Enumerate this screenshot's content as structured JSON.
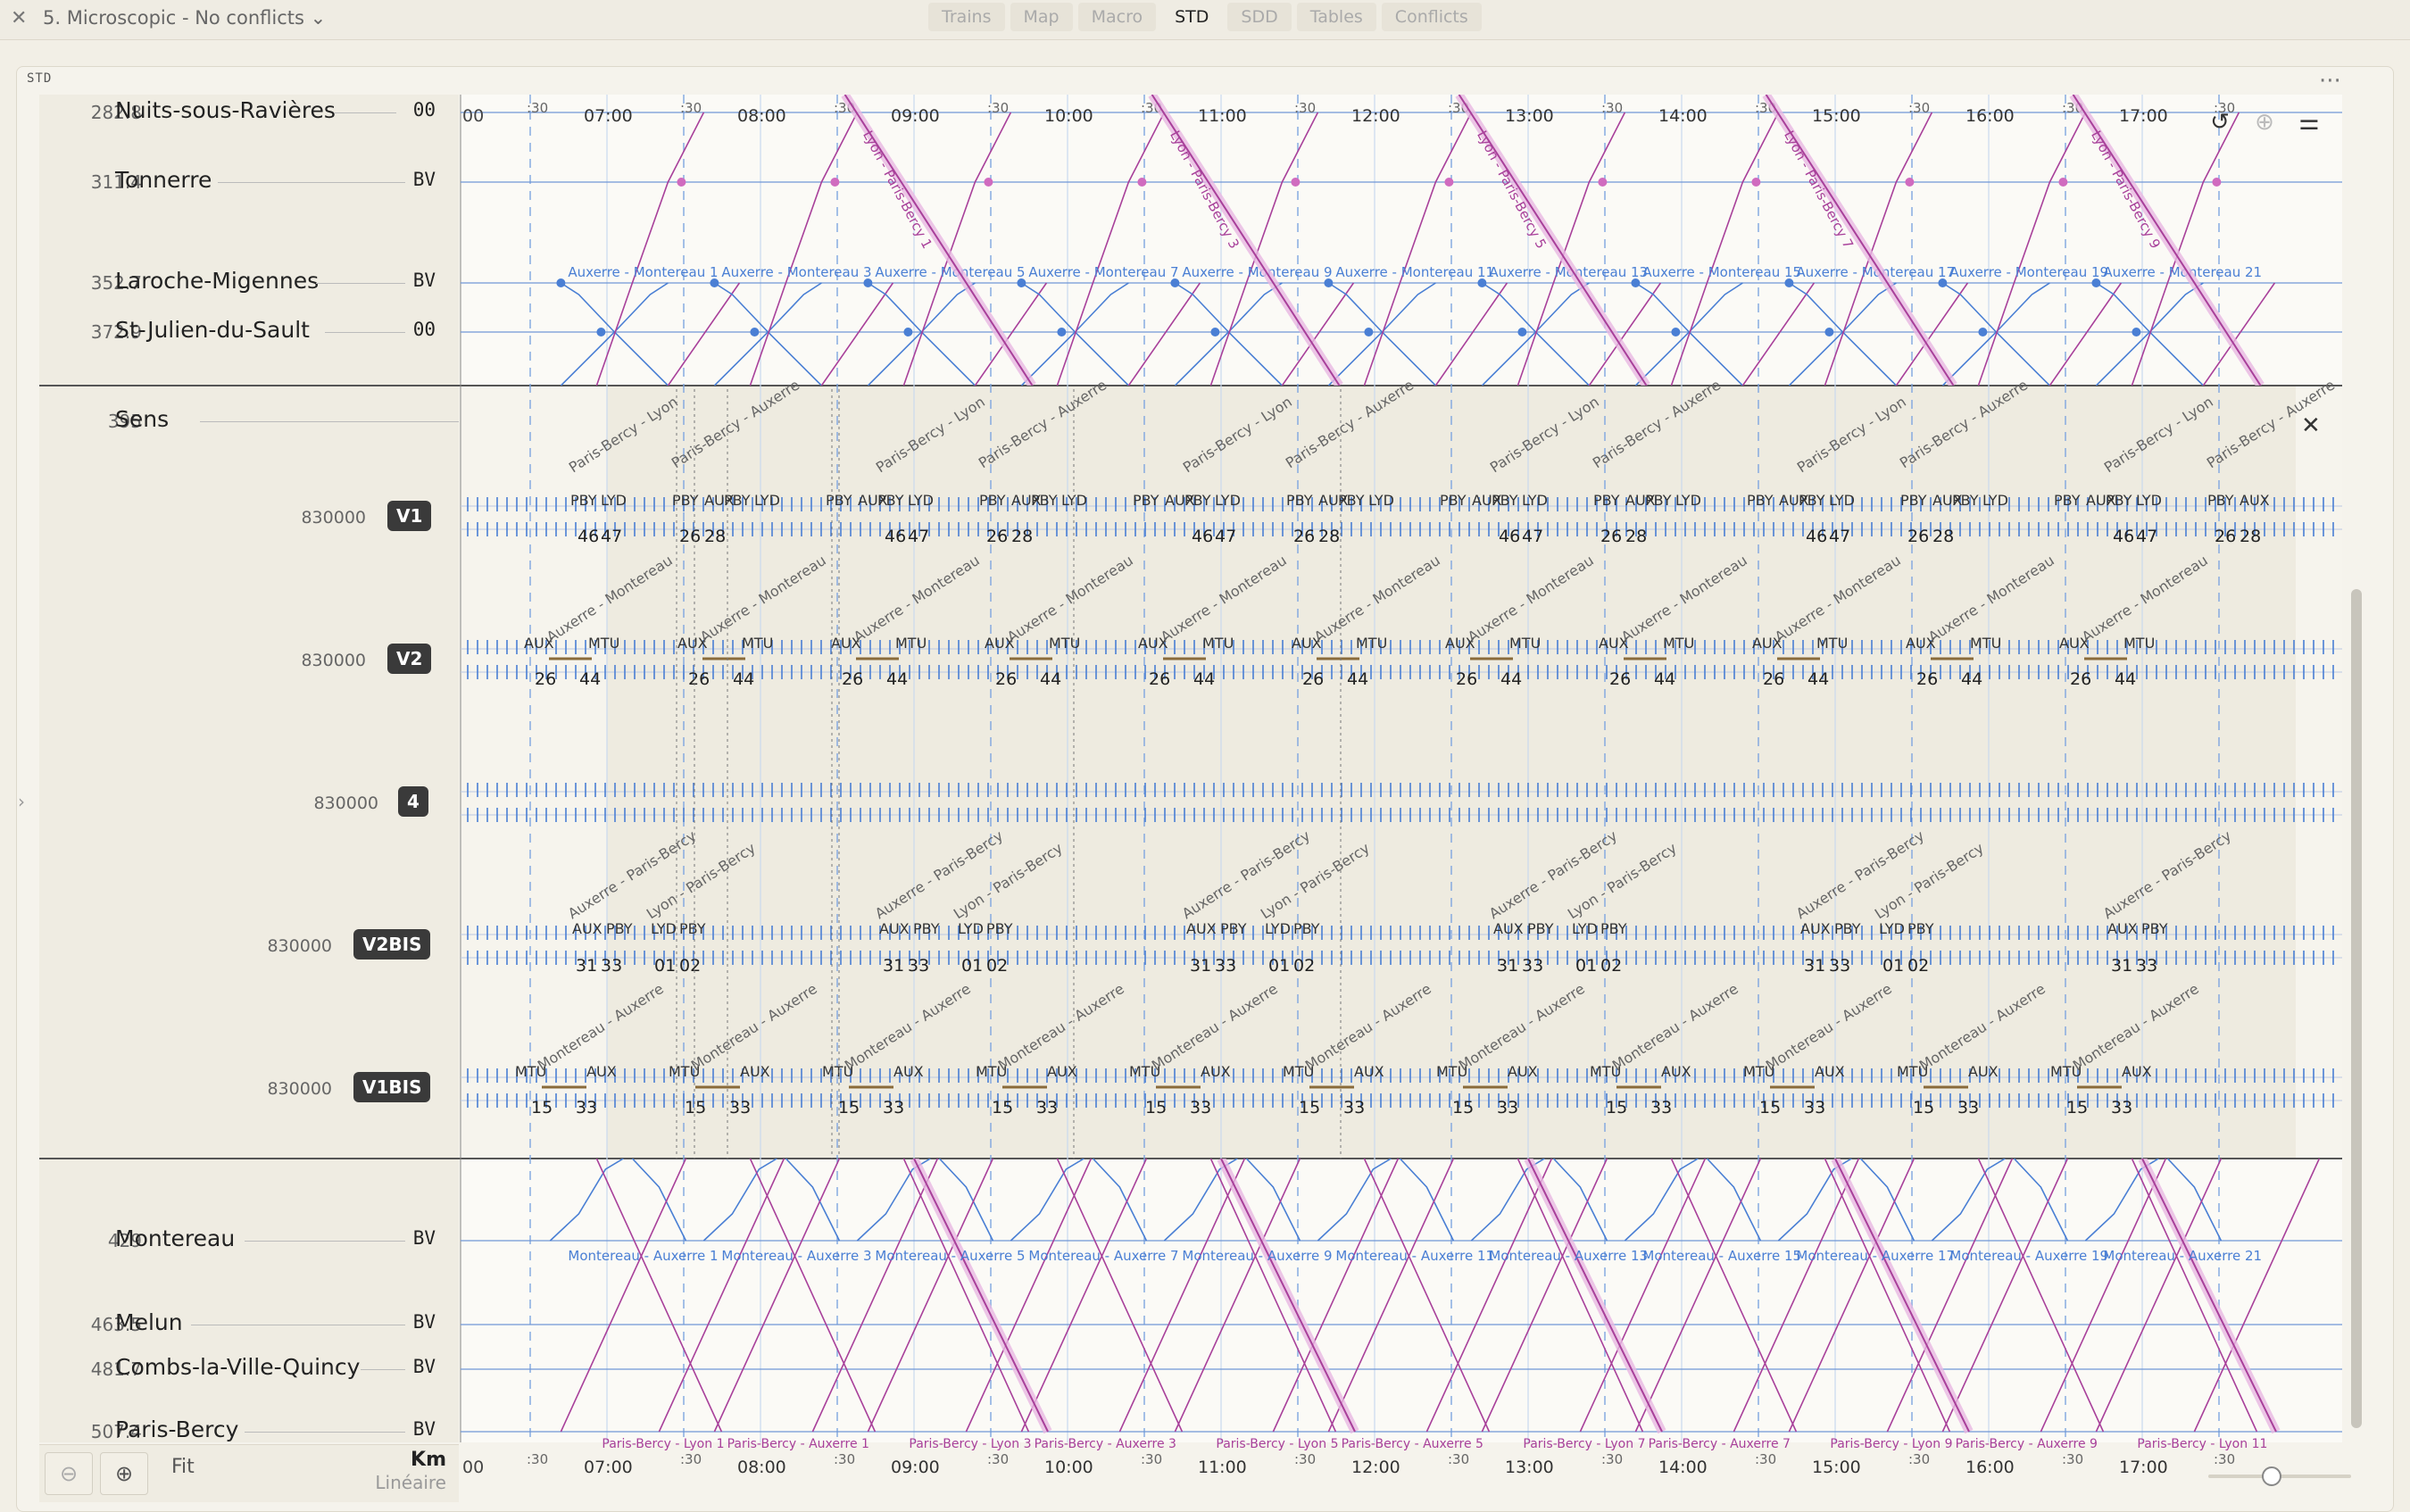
{
  "topbar": {
    "close_icon": "x-icon",
    "scenario": "5. Microscopic - No conflicts",
    "tabs": [
      "Trains",
      "Map",
      "Macro",
      "STD",
      "SDD",
      "Tables",
      "Conflicts"
    ],
    "active_tab": "STD"
  },
  "panel": {
    "title": "STD"
  },
  "stations_top": [
    {
      "km": "282.8",
      "name": "Nuits-sous-Ravières",
      "code": "00"
    },
    {
      "km": "311.4",
      "name": "Tonnerre",
      "code": "BV"
    },
    {
      "km": "352.7",
      "name": "Laroche-Migennes",
      "code": "BV"
    },
    {
      "km": "372.9",
      "name": "St-Julien-du-Sault",
      "code": "00"
    }
  ],
  "station_middle": {
    "km": "395",
    "name": "Sens"
  },
  "tracks": [
    {
      "code": "830000",
      "badge": "V1"
    },
    {
      "code": "830000",
      "badge": "V2"
    },
    {
      "code": "830000",
      "badge": "4"
    },
    {
      "code": "830000",
      "badge": "V2BIS"
    },
    {
      "code": "830000",
      "badge": "V1BIS"
    }
  ],
  "stations_bottom": [
    {
      "km": "429",
      "name": "Montereau",
      "code": "BV"
    },
    {
      "km": "463.5",
      "name": "Melun",
      "code": "BV"
    },
    {
      "km": "481.7",
      "name": "Combs-la-Ville-Quincy",
      "code": "BV"
    },
    {
      "km": "507.4",
      "name": "Paris-Bercy",
      "code": "BV"
    }
  ],
  "time_axis": {
    "hours": [
      "07:00",
      "08:00",
      "09:00",
      "10:00",
      "11:00",
      "12:00",
      "13:00",
      "14:00",
      "15:00",
      "16:00",
      "17:00"
    ],
    "half_label": ":30",
    "first_partial": "00"
  },
  "train_labels": {
    "auxerre_montereau": [
      "Auxerre - Montereau 1",
      "Auxerre - Montereau 3",
      "Auxerre - Montereau 5",
      "Auxerre - Montereau 7",
      "Auxerre - Montereau 9",
      "Auxerre - Montereau 11",
      "Auxerre - Montereau 13",
      "Auxerre - Montereau 15",
      "Auxerre - Montereau 17",
      "Auxerre - Montereau 19",
      "Auxerre - Montereau 21"
    ],
    "montereau_auxerre": [
      "Montereau - Auxerre 1",
      "Montereau - Auxerre 3",
      "Montereau - Auxerre 5",
      "Montereau - Auxerre 7",
      "Montereau - Auxerre 9",
      "Montereau - Auxerre 11",
      "Montereau - Auxerre 13",
      "Montereau - Auxerre 15",
      "Montereau - Auxerre 17",
      "Montereau - Auxerre 19",
      "Montereau - Auxerre 21"
    ],
    "lyon_paris": [
      "Lyon - Paris-Bercy 1",
      "Lyon - Paris-Bercy 3",
      "Lyon - Paris-Bercy 5",
      "Lyon - Paris-Bercy 7",
      "Lyon - Paris-Bercy 9"
    ],
    "paris_lyon": [
      "Paris-Bercy - Lyon 1",
      "Paris-Bercy - Lyon 3",
      "Paris-Bercy - Lyon 5",
      "Paris-Bercy - Lyon 7",
      "Paris-Bercy - Lyon 9",
      "Paris-Bercy - Lyon 11"
    ],
    "paris_auxerre": [
      "Paris-Bercy - Auxerre 1",
      "Paris-Bercy - Auxerre 3",
      "Paris-Bercy - Auxerre 5",
      "Paris-Bercy - Auxerre 7",
      "Paris-Bercy - Auxerre 9"
    ],
    "sens_diag": {
      "pby_lyon": "Paris-Bercy - Lyon",
      "pby_aux": "Paris-Bercy - Auxerre",
      "aux_mtu": "Auxerre - Montereau",
      "aux_pby": "Auxerre - Paris-Bercy",
      "lyon_pby": "Lyon - Paris-Bercy",
      "mtu_aux": "Montereau - Auxerre"
    }
  },
  "track_markers": {
    "v1": {
      "top": [
        "PBY",
        "LYD",
        "PBY",
        "AUX"
      ],
      "bottom": [
        "46",
        "47",
        "26",
        "28"
      ]
    },
    "v2": {
      "top": [
        "AUX",
        "MTU"
      ],
      "bottom": [
        "26",
        "44"
      ]
    },
    "v2bis": {
      "top_a": [
        "LYD",
        "PBY"
      ],
      "top_b": [
        "AUX",
        "PBY"
      ],
      "bottom_a": [
        "01",
        "02"
      ],
      "bottom_b": [
        "31",
        "33"
      ]
    },
    "v1bis": {
      "top": [
        "MTU",
        "AUX"
      ],
      "bottom": [
        "15",
        "33"
      ]
    }
  },
  "colors": {
    "blue": "#4a7fd4",
    "magenta": "#a8409a",
    "highlight": "#e9b8e3",
    "band": "#e8e4d6"
  },
  "bottombar": {
    "zoom_out_icon": "zoom-out-icon",
    "zoom_in_icon": "zoom-in-icon",
    "fit": "Fit",
    "unit": "Km",
    "mode": "Linéaire"
  },
  "tools": [
    "reset-icon",
    "zoom-icon",
    "settings-sliders-icon"
  ]
}
